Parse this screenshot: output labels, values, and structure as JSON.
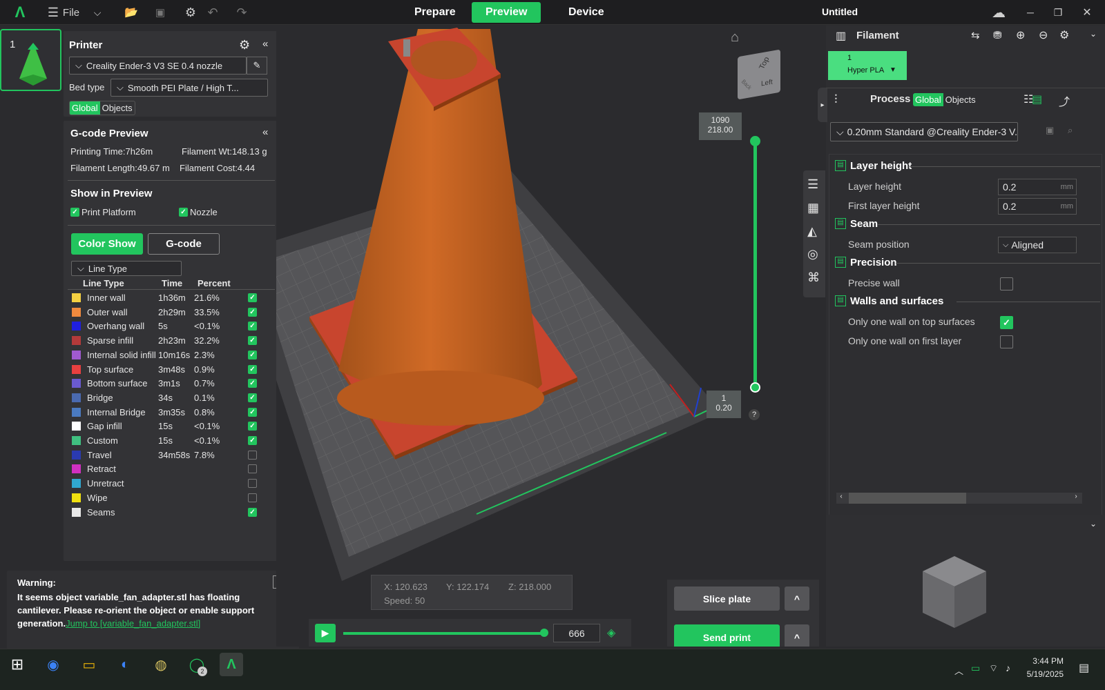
{
  "app": {
    "title": "Untitled",
    "menu_label": "File",
    "accent": "#22c55e",
    "tabs": [
      {
        "label": "Prepare"
      },
      {
        "label": "Preview"
      },
      {
        "label": "Device"
      }
    ]
  },
  "plate": {
    "number": "1"
  },
  "printer": {
    "title": "Printer",
    "printer_name": "Creality Ender-3 V3 SE 0.4 nozzle",
    "bed_type_label": "Bed type",
    "bed_type": "Smooth PEI Plate / High T...",
    "scope": [
      "Global",
      "Objects"
    ]
  },
  "preview": {
    "title": "G-code Preview",
    "printing_time": "Printing Time:7h26m",
    "filament_wt": "Filament Wt:148.13 g",
    "filament_length": "Filament Length:49.67 m",
    "filament_cost": "Filament Cost:4.44",
    "show_title": "Show in Preview",
    "print_platform": "Print Platform",
    "nozzle": "Nozzle",
    "color_show": "Color Show",
    "gcode": "G-code",
    "view_type": "Line Type",
    "columns": [
      "Line Type",
      "Time",
      "Percent"
    ],
    "rows": [
      {
        "color": "#f5d142",
        "name": "Inner wall",
        "time": "1h36m",
        "percent": "21.6%",
        "checked": true
      },
      {
        "color": "#f08a3e",
        "name": "Outer wall",
        "time": "2h29m",
        "percent": "33.5%",
        "checked": true
      },
      {
        "color": "#1f1fe0",
        "name": "Overhang wall",
        "time": "5s",
        "percent": "<0.1%",
        "checked": true
      },
      {
        "color": "#b43a3a",
        "name": "Sparse infill",
        "time": "2h23m",
        "percent": "32.2%",
        "checked": true
      },
      {
        "color": "#a05ad0",
        "name": "Internal solid infill",
        "time": "10m16s",
        "percent": "2.3%",
        "checked": true
      },
      {
        "color": "#e84040",
        "name": "Top surface",
        "time": "3m48s",
        "percent": "0.9%",
        "checked": true
      },
      {
        "color": "#6a5ad0",
        "name": "Bottom surface",
        "time": "3m1s",
        "percent": "0.7%",
        "checked": true
      },
      {
        "color": "#4a6ab0",
        "name": "Bridge",
        "time": "34s",
        "percent": "0.1%",
        "checked": true
      },
      {
        "color": "#4a7ac0",
        "name": "Internal Bridge",
        "time": "3m35s",
        "percent": "0.8%",
        "checked": true
      },
      {
        "color": "#ffffff",
        "name": "Gap infill",
        "time": "15s",
        "percent": "<0.1%",
        "checked": true
      },
      {
        "color": "#40c080",
        "name": "Custom",
        "time": "15s",
        "percent": "<0.1%",
        "checked": true
      },
      {
        "color": "#2a3ab0",
        "name": "Travel",
        "time": "34m58s",
        "percent": "7.8%",
        "checked": false
      },
      {
        "color": "#d030c0",
        "name": "Retract",
        "time": "",
        "percent": "",
        "checked": false
      },
      {
        "color": "#30a8d0",
        "name": "Unretract",
        "time": "",
        "percent": "",
        "checked": false
      },
      {
        "color": "#f0e010",
        "name": "Wipe",
        "time": "",
        "percent": "",
        "checked": false
      },
      {
        "color": "#e8e8e8",
        "name": "Seams",
        "time": "",
        "percent": "",
        "checked": true
      }
    ]
  },
  "warning": {
    "title": "Warning:",
    "message": "It seems object variable_fan_adapter.stl has floating cantilever. Please re-orient the object or enable support generation.",
    "link": "Jump to [variable_fan_adapter.stl]"
  },
  "viewport": {
    "layer_top": "1090",
    "height_top": "218.00",
    "layer_bottom": "1",
    "height_bottom": "0.20",
    "cube_labels": [
      "Top",
      "Left",
      "Back"
    ],
    "coords": {
      "x_label": "X:",
      "x": "120.623",
      "y_label": "Y:",
      "y": "122.174",
      "z_label": "Z:",
      "z": "218.000",
      "speed_label": "Speed:",
      "speed": "50"
    },
    "move_value": "666",
    "help": "?"
  },
  "actions": {
    "slice": "Slice plate",
    "send": "Send print",
    "caret": "^"
  },
  "filament": {
    "title": "Filament",
    "slot_number": "1",
    "slot_name": "Hyper PLA",
    "slot_color": "#4ade80"
  },
  "process": {
    "title": "Process",
    "scope": [
      "Global",
      "Objects"
    ],
    "preset": "0.20mm Standard @Creality Ender-3 V...",
    "groups": [
      {
        "title": "Layer height",
        "items": [
          {
            "name": "Layer height",
            "value": "0.2",
            "unit": "mm"
          },
          {
            "name": "First layer height",
            "value": "0.2",
            "unit": "mm"
          }
        ]
      },
      {
        "title": "Seam",
        "items": [
          {
            "name": "Seam position",
            "value": "Aligned"
          }
        ]
      },
      {
        "title": "Precision",
        "items": [
          {
            "name": "Precise wall",
            "checked": false
          }
        ]
      },
      {
        "title": "Walls and surfaces",
        "items": [
          {
            "name": "Only one wall on top surfaces",
            "checked": true
          },
          {
            "name": "Only one wall on first layer",
            "checked": false
          }
        ]
      }
    ]
  },
  "taskbar": {
    "time": "3:44 PM",
    "date": "5/19/2025",
    "whatsapp_badge": "2"
  }
}
